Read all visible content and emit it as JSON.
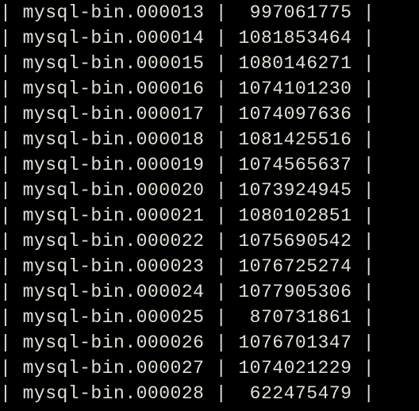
{
  "rows": [
    {
      "name": "mysql-bin.000013",
      "size": "997061775"
    },
    {
      "name": "mysql-bin.000014",
      "size": "1081853464"
    },
    {
      "name": "mysql-bin.000015",
      "size": "1080146271"
    },
    {
      "name": "mysql-bin.000016",
      "size": "1074101230"
    },
    {
      "name": "mysql-bin.000017",
      "size": "1074097636"
    },
    {
      "name": "mysql-bin.000018",
      "size": "1081425516"
    },
    {
      "name": "mysql-bin.000019",
      "size": "1074565637"
    },
    {
      "name": "mysql-bin.000020",
      "size": "1073924945"
    },
    {
      "name": "mysql-bin.000021",
      "size": "1080102851"
    },
    {
      "name": "mysql-bin.000022",
      "size": "1075690542"
    },
    {
      "name": "mysql-bin.000023",
      "size": "1076725274"
    },
    {
      "name": "mysql-bin.000024",
      "size": "1077905306"
    },
    {
      "name": "mysql-bin.000025",
      "size": "870731861"
    },
    {
      "name": "mysql-bin.000026",
      "size": "1076701347"
    },
    {
      "name": "mysql-bin.000027",
      "size": "1074021229"
    },
    {
      "name": "mysql-bin.000028",
      "size": "622475479"
    }
  ],
  "column_widths": {
    "name": 16,
    "size": 10
  }
}
